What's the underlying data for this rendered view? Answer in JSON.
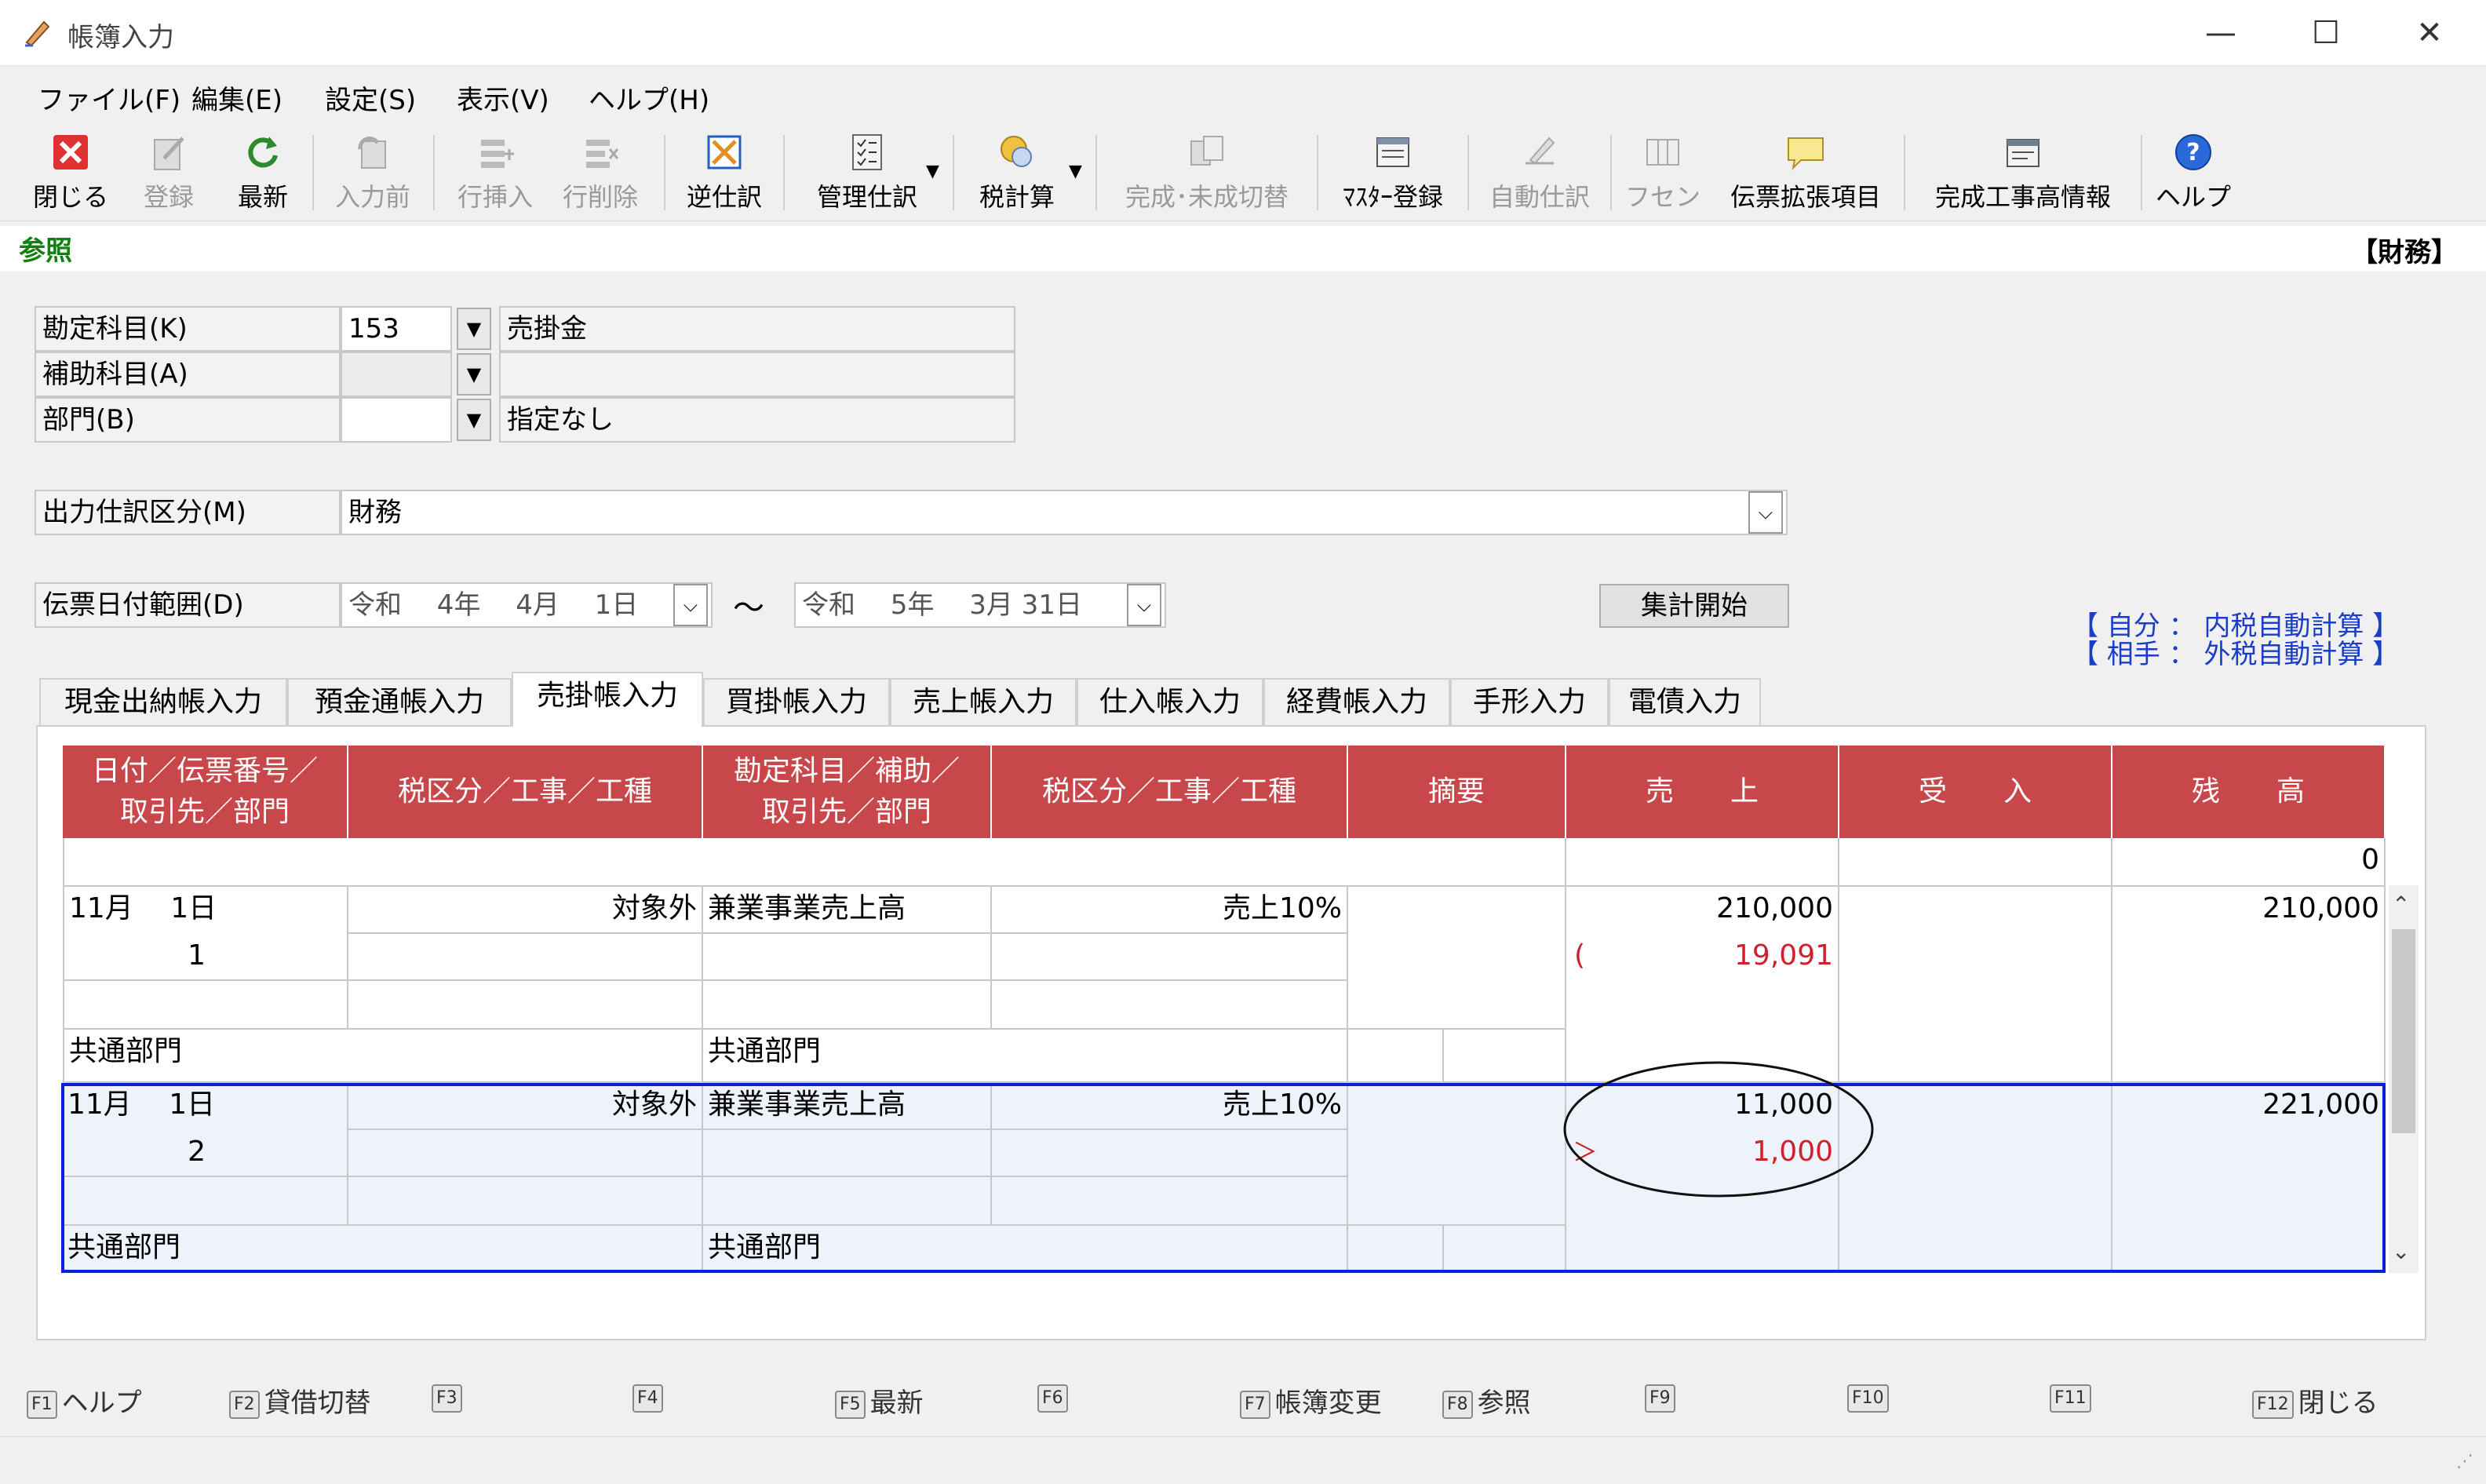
{
  "window": {
    "title": "帳簿入力",
    "minimize": "—",
    "maximize": "☐",
    "close": "✕"
  },
  "menu": [
    "ファイル(F)",
    "編集(E)",
    "設定(S)",
    "表示(V)",
    "ヘルプ(H)"
  ],
  "toolbar": [
    {
      "label": "閉じる",
      "icon": "close-icon",
      "enabled": true
    },
    {
      "label": "登録",
      "icon": "register-icon",
      "enabled": false
    },
    {
      "label": "最新",
      "icon": "refresh-icon",
      "enabled": true
    },
    {
      "label": "入力前",
      "icon": "undo-icon",
      "enabled": false
    },
    {
      "label": "行挿入",
      "icon": "insert-row-icon",
      "enabled": false
    },
    {
      "label": "行削除",
      "icon": "delete-row-icon",
      "enabled": false
    },
    {
      "label": "逆仕訳",
      "icon": "reverse-entry-icon",
      "enabled": true
    },
    {
      "label": "管理仕訳",
      "icon": "management-entry-icon",
      "enabled": true
    },
    {
      "label": "税計算",
      "icon": "tax-calc-icon",
      "enabled": true
    },
    {
      "label": "完成･未成切替",
      "icon": "completion-switch-icon",
      "enabled": false
    },
    {
      "label": "ﾏｽﾀｰ登録",
      "icon": "master-register-icon",
      "enabled": true
    },
    {
      "label": "自動仕訳",
      "icon": "auto-entry-icon",
      "enabled": false
    },
    {
      "label": "フセン",
      "icon": "sticky-note-icon",
      "enabled": false
    },
    {
      "label": "伝票拡張項目",
      "icon": "voucher-ext-icon",
      "enabled": true
    },
    {
      "label": "完成工事高情報",
      "icon": "construction-info-icon",
      "enabled": true
    },
    {
      "label": "ヘルプ",
      "icon": "help-icon",
      "enabled": true
    }
  ],
  "refbar": {
    "left": "参照",
    "right": "【財務】"
  },
  "form": {
    "account": {
      "label": "勘定科目(K)",
      "code": "153",
      "name": "売掛金"
    },
    "sub_account": {
      "label": "補助科目(A)",
      "code": "",
      "name": ""
    },
    "department": {
      "label": "部門(B)",
      "code": "",
      "name": "指定なし"
    },
    "output_type": {
      "label": "出力仕訳区分(M)",
      "value": "財務"
    },
    "date_range": {
      "label": "伝票日付範囲(D)",
      "from": "令和　 4年　 4月　 1日",
      "separator": "～",
      "to": "令和　 5年　 3月 31日"
    },
    "sum_button": "集計開始",
    "tax_note_1": "【 自分 ： 内税自動計算 】",
    "tax_note_2": "【 相手 ： 外税自動計算 】"
  },
  "tabs": [
    "現金出納帳入力",
    "預金通帳入力",
    "売掛帳入力",
    "買掛帳入力",
    "売上帳入力",
    "仕入帳入力",
    "経費帳入力",
    "手形入力",
    "電債入力"
  ],
  "active_tab": "売掛帳入力",
  "grid": {
    "headers": {
      "date": "日付／伝票番号／\n取引先／部門",
      "tax1": "税区分／工事／工種",
      "account": "勘定科目／補助／\n取引先／部門",
      "tax2": "税区分／工事／工種",
      "summary": "摘要",
      "sales": "売　　上",
      "receipt": "受　　入",
      "balance": "残　　高"
    },
    "opening_balance": "0",
    "rows": [
      {
        "date": "11月　 1日",
        "slip": "1",
        "tax1": "対象外",
        "account": "兼業事業売上高",
        "tax2": "売上10%",
        "sales": "210,000",
        "tax_amount": "19,091",
        "tax_mark": "(",
        "balance": "210,000",
        "dept1": "共通部門",
        "dept2": "共通部門"
      },
      {
        "date": "11月　 1日",
        "slip": "2",
        "tax1": "対象外",
        "account": "兼業事業売上高",
        "tax2": "売上10%",
        "sales": "11,000",
        "tax_amount": "1,000",
        "tax_mark": "＞",
        "balance": "221,000",
        "dept1": "共通部門",
        "dept2": "共通部門"
      }
    ]
  },
  "fkeys": [
    {
      "key": "F1",
      "label": "ヘルプ"
    },
    {
      "key": "F2",
      "label": "貸借切替"
    },
    {
      "key": "F3",
      "label": ""
    },
    {
      "key": "F4",
      "label": ""
    },
    {
      "key": "F5",
      "label": "最新"
    },
    {
      "key": "F6",
      "label": ""
    },
    {
      "key": "F7",
      "label": "帳簿変更"
    },
    {
      "key": "F8",
      "label": "参照"
    },
    {
      "key": "F9",
      "label": ""
    },
    {
      "key": "F10",
      "label": ""
    },
    {
      "key": "F11",
      "label": ""
    },
    {
      "key": "F12",
      "label": "閉じる"
    }
  ],
  "colors": {
    "header_red": "#c8474a",
    "selection_blue": "#0a1ee0",
    "tax_red": "#d0202a",
    "note_blue": "#1a3ec8",
    "ref_green": "#108010"
  }
}
